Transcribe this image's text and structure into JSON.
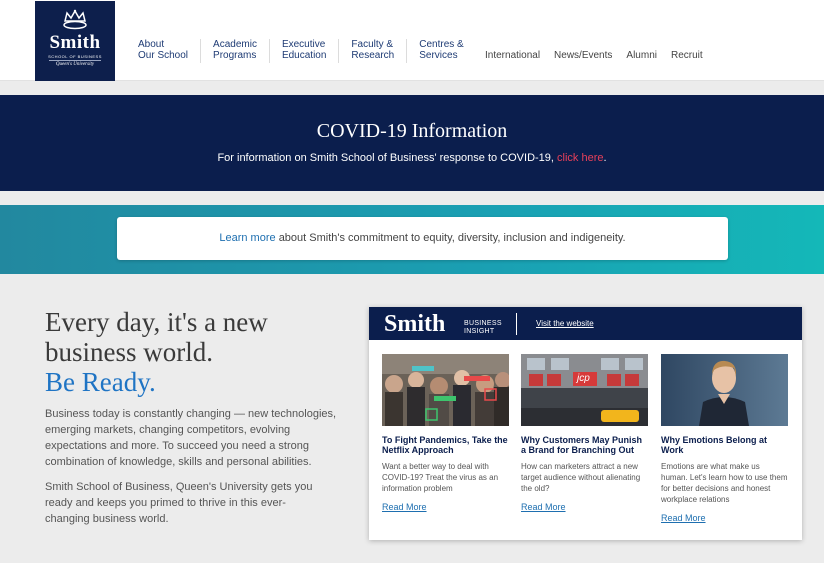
{
  "logo": {
    "brand": "Smith",
    "subtitle": "SCHOOL OF BUSINESS",
    "university": "Queen's University",
    "icon": "crown-icon"
  },
  "nav": {
    "main": [
      {
        "line1": "About",
        "line2": "Our School"
      },
      {
        "line1": "Academic",
        "line2": "Programs"
      },
      {
        "line1": "Executive",
        "line2": "Education"
      },
      {
        "line1": "Faculty &",
        "line2": "Research"
      },
      {
        "line1": "Centres &",
        "line2": "Services"
      }
    ],
    "secondary": [
      "International",
      "News/Events",
      "Alumni",
      "Recruit"
    ]
  },
  "covid": {
    "title": "COVID-19 Information",
    "text_before": "For information on Smith School of Business' response to COVID-19,",
    "link": "click here",
    "text_after": "."
  },
  "equity": {
    "link": "Learn more",
    "text": "about Smith's commitment to equity, diversity, inclusion and indigeneity."
  },
  "hero": {
    "line1": "Every day, it's a new",
    "line2": "business world.",
    "line3": "Be Ready.",
    "para1": "Business today is constantly changing — new technologies, emerging markets, changing competitors, evolving expectations and more. To succeed you need a strong combination of knowledge, skills and personal abilities.",
    "para2": "Smith School of Business, Queen's University gets you ready and keeps you primed to thrive in this ever-changing business world."
  },
  "insight": {
    "brand": "Smith",
    "business": "BUSINESS",
    "insight": "INSIGHT",
    "visit": "Visit the website",
    "read_more": "Read More",
    "articles": [
      {
        "title": "To Fight Pandemics, Take the Netflix Approach",
        "text": "Want a better way to deal with COVID-19? Treat the virus as an information problem",
        "tags": [
          "HEALTHY",
          "INFECTED",
          "HEALTHY"
        ]
      },
      {
        "title": "Why Customers May Punish a Brand for Branching Out",
        "text": "How can marketers attract a new target audience without alienating the old?",
        "store": "jcp"
      },
      {
        "title": "Why Emotions Belong at Work",
        "text": "Emotions are what make us human. Let's learn how to use them for better decisions and honest workplace relations"
      }
    ]
  },
  "colors": {
    "navy": "#0b1e4d",
    "link_blue": "#1e6fb0",
    "accent_blue": "#1f74c4",
    "covid_link": "#e8405a",
    "teal": "#1aa0b3"
  }
}
